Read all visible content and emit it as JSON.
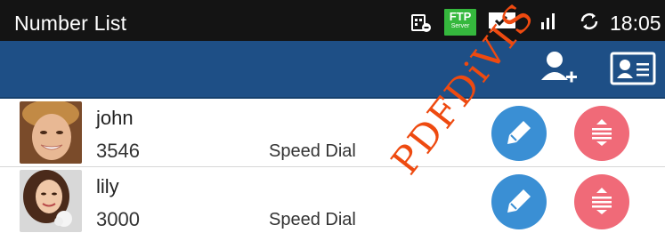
{
  "status_bar": {
    "title": "Number List",
    "ftp_label": "FTP",
    "ftp_sublabel": "Server",
    "time": "18:05",
    "icons": [
      "sim-card-icon",
      "ftp-server-icon",
      "chat-icon",
      "signal-icon",
      "sync-icon"
    ]
  },
  "action_bar": {
    "buttons": [
      "add-contact-icon",
      "contact-card-icon"
    ],
    "background": "#1e4f86"
  },
  "contacts": [
    {
      "name": "john",
      "number": "3546",
      "type": "Speed Dial"
    },
    {
      "name": "lily",
      "number": "3000",
      "type": "Speed Dial"
    }
  ],
  "row_actions": {
    "edit_icon": "pencil-icon",
    "delete_icon": "drag-handle-icon",
    "edit_color": "#3a8fd4",
    "delete_color": "#f06a78"
  },
  "watermark": "PDFDiVIS"
}
